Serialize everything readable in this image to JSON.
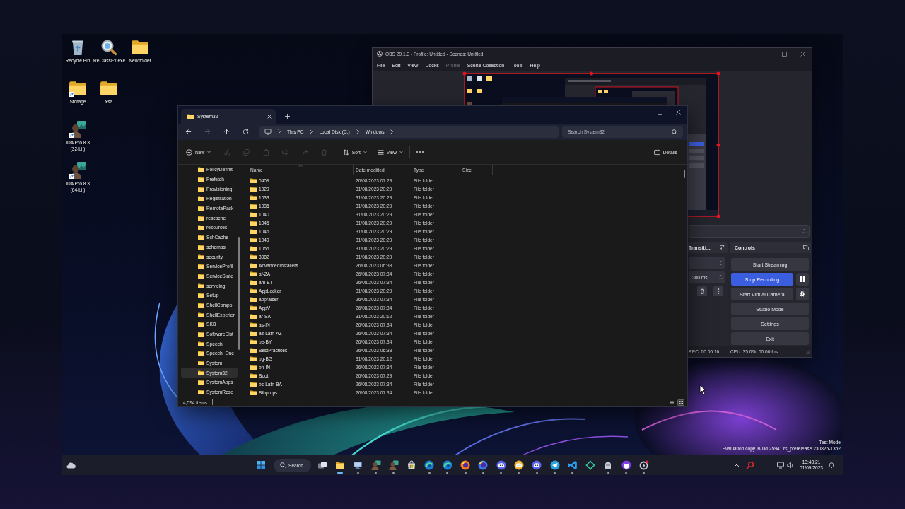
{
  "desktop_icon_rows": [
    [
      {
        "label": "Recycle Bin",
        "kind": "recycle-bin",
        "shortcut": false
      },
      {
        "label": "ReClassEx.exe",
        "kind": "magnifier-app",
        "shortcut": false
      },
      {
        "label": "New folder",
        "kind": "folder",
        "shortcut": false
      }
    ],
    [
      {
        "label": "Storage",
        "kind": "folder",
        "shortcut": true
      },
      {
        "label": "xsa",
        "kind": "folder",
        "shortcut": false
      }
    ],
    [
      {
        "label": "IDA Pro 8.3 (32-bit)",
        "kind": "portrait-app",
        "shortcut": true
      }
    ],
    [
      {
        "label": "IDA Pro 8.3 (64-bit)",
        "kind": "portrait-app",
        "shortcut": true
      }
    ]
  ],
  "obs": {
    "title": "OBS 29.1.3 - Profile: Untitled - Scenes: Untitled",
    "menu": [
      {
        "label": "File",
        "disabled": false
      },
      {
        "label": "Edit",
        "disabled": false
      },
      {
        "label": "View",
        "disabled": false
      },
      {
        "label": "Docks",
        "disabled": false
      },
      {
        "label": "Profile",
        "disabled": true
      },
      {
        "label": "Scene Collection",
        "disabled": false
      },
      {
        "label": "Tools",
        "disabled": false
      },
      {
        "label": "Help",
        "disabled": false
      }
    ],
    "transitions": {
      "title": "Transiti...",
      "duration": "300 ms"
    },
    "controls": {
      "title": "Controls",
      "buttons": [
        {
          "label": "Start Streaming",
          "active": false
        },
        {
          "label": "Stop Recording",
          "active": true,
          "side_button": {
            "kind": "pause"
          }
        },
        {
          "label": "Start Virtual Camera",
          "active": false,
          "side_button": {
            "kind": "settings"
          }
        },
        {
          "label": "Studio Mode",
          "active": false
        },
        {
          "label": "Settings",
          "active": false
        },
        {
          "label": "Exit",
          "active": false
        }
      ]
    },
    "status": {
      "recording": "REC: 00:00:16",
      "cpu": "CPU: 35.0%, 60.00 fps"
    }
  },
  "explorer": {
    "tabs": [
      {
        "title": "System32",
        "selected": true
      }
    ],
    "nav": [
      {
        "kind": "back",
        "disabled": false
      },
      {
        "kind": "forward",
        "disabled": true
      },
      {
        "kind": "up",
        "disabled": false
      },
      {
        "kind": "refresh",
        "disabled": false
      }
    ],
    "breadcrumbs": [
      "This PC",
      "Local Disk (C:)",
      "Windows"
    ],
    "search": {
      "placeholder": "Search System32"
    },
    "toolbar": {
      "new": "New",
      "actions": [
        {
          "kind": "cut",
          "disabled": true
        },
        {
          "kind": "copy",
          "disabled": true
        },
        {
          "kind": "paste",
          "disabled": true
        },
        {
          "kind": "rename",
          "disabled": true
        },
        {
          "kind": "share",
          "disabled": true
        },
        {
          "kind": "delete",
          "disabled": true
        }
      ],
      "sort": "Sort",
      "view": "View",
      "details": "Details"
    },
    "sidebar": [
      {
        "label": "PolicyDefinit",
        "selected": false
      },
      {
        "label": "Prefetch",
        "selected": false
      },
      {
        "label": "Provisioning",
        "selected": false
      },
      {
        "label": "Registration",
        "selected": false
      },
      {
        "label": "RemotePack",
        "selected": false
      },
      {
        "label": "rescache",
        "selected": false
      },
      {
        "label": "resources",
        "selected": false
      },
      {
        "label": "SchCache",
        "selected": false
      },
      {
        "label": "schemas",
        "selected": false
      },
      {
        "label": "security",
        "selected": false
      },
      {
        "label": "ServiceProfil",
        "selected": false
      },
      {
        "label": "ServiceState",
        "selected": false
      },
      {
        "label": "servicing",
        "selected": false
      },
      {
        "label": "Setup",
        "selected": false
      },
      {
        "label": "ShellCompo",
        "selected": false
      },
      {
        "label": "ShellExperien",
        "selected": false
      },
      {
        "label": "SKB",
        "selected": false
      },
      {
        "label": "SoftwareDist",
        "selected": false
      },
      {
        "label": "Speech",
        "selected": false
      },
      {
        "label": "Speech_One",
        "selected": false
      },
      {
        "label": "System",
        "selected": false
      },
      {
        "label": "System32",
        "selected": true
      },
      {
        "label": "SystemApps",
        "selected": false
      },
      {
        "label": "SystemReso",
        "selected": false
      }
    ],
    "columns": [
      "Name",
      "Date modified",
      "Type",
      "Size"
    ],
    "rows": [
      {
        "name": "0409",
        "date": "26/08/2023 07:29",
        "type": "File folder"
      },
      {
        "name": "1029",
        "date": "31/08/2023 20:29",
        "type": "File folder"
      },
      {
        "name": "1033",
        "date": "31/08/2023 20:29",
        "type": "File folder"
      },
      {
        "name": "1036",
        "date": "31/08/2023 20:29",
        "type": "File folder"
      },
      {
        "name": "1040",
        "date": "31/08/2023 20:29",
        "type": "File folder"
      },
      {
        "name": "1045",
        "date": "31/08/2023 20:29",
        "type": "File folder"
      },
      {
        "name": "1046",
        "date": "31/08/2023 20:29",
        "type": "File folder"
      },
      {
        "name": "1049",
        "date": "31/08/2023 20:29",
        "type": "File folder"
      },
      {
        "name": "1055",
        "date": "31/08/2023 20:29",
        "type": "File folder"
      },
      {
        "name": "3082",
        "date": "31/08/2023 20:29",
        "type": "File folder"
      },
      {
        "name": "AdvancedInstallers",
        "date": "26/08/2023 06:38",
        "type": "File folder"
      },
      {
        "name": "af-ZA",
        "date": "26/08/2023 07:34",
        "type": "File folder"
      },
      {
        "name": "am-ET",
        "date": "26/08/2023 07:34",
        "type": "File folder"
      },
      {
        "name": "AppLocker",
        "date": "31/08/2023 20:29",
        "type": "File folder"
      },
      {
        "name": "appraiser",
        "date": "26/08/2023 07:34",
        "type": "File folder"
      },
      {
        "name": "AppV",
        "date": "26/08/2023 07:34",
        "type": "File folder"
      },
      {
        "name": "ar-SA",
        "date": "31/08/2023 20:12",
        "type": "File folder"
      },
      {
        "name": "as-IN",
        "date": "26/08/2023 07:34",
        "type": "File folder"
      },
      {
        "name": "az-Latn-AZ",
        "date": "26/08/2023 07:34",
        "type": "File folder"
      },
      {
        "name": "be-BY",
        "date": "26/08/2023 07:34",
        "type": "File folder"
      },
      {
        "name": "BestPractices",
        "date": "26/08/2023 06:38",
        "type": "File folder"
      },
      {
        "name": "bg-BG",
        "date": "31/08/2023 20:12",
        "type": "File folder"
      },
      {
        "name": "bn-IN",
        "date": "26/08/2023 07:34",
        "type": "File folder"
      },
      {
        "name": "Boot",
        "date": "26/08/2023 07:29",
        "type": "File folder"
      },
      {
        "name": "bs-Latn-BA",
        "date": "26/08/2023 07:34",
        "type": "File folder"
      },
      {
        "name": "Bthprops",
        "date": "26/08/2023 07:34",
        "type": "File folder"
      }
    ],
    "status": "4,594 items",
    "view_modes": [
      {
        "kind": "details",
        "selected": false
      },
      {
        "kind": "tiles",
        "selected": true
      }
    ]
  },
  "system_notice": [
    "Test Mode",
    "Evaluation copy. Build 25941.rs_prerelease.230825-1352"
  ],
  "taskbar": {
    "search": "Search",
    "apps": [
      {
        "kind": "task-view",
        "running": false,
        "selected": false
      },
      {
        "kind": "folder",
        "running": true,
        "selected": true
      },
      {
        "kind": "monitor",
        "running": true,
        "selected": false
      },
      {
        "kind": "portrait-app",
        "running": true,
        "selected": false
      },
      {
        "kind": "portrait-app",
        "running": true,
        "selected": false
      },
      {
        "kind": "store",
        "running": false,
        "selected": false
      },
      {
        "kind": "swirl",
        "running": true,
        "selected": false
      },
      {
        "kind": "swirl",
        "running": true,
        "selected": false
      },
      {
        "kind": "flame-globe",
        "color": "#ff7a1a",
        "running": true,
        "selected": false
      },
      {
        "kind": "flame-globe",
        "color": "#3a7bea",
        "running": true,
        "selected": false
      },
      {
        "kind": "controller",
        "color": "#5865f2",
        "running": true,
        "selected": false
      },
      {
        "kind": "controller",
        "color": "#f0b232",
        "running": true,
        "selected": false
      },
      {
        "kind": "controller",
        "color": "#5865f2",
        "running": true,
        "selected": false
      },
      {
        "kind": "paper-plane",
        "running": true,
        "selected": false
      },
      {
        "kind": "code",
        "running": true,
        "selected": false
      },
      {
        "kind": "diamond",
        "running": false,
        "selected": false
      },
      {
        "kind": "ghost",
        "running": true,
        "selected": false
      },
      {
        "kind": "cat",
        "running": true,
        "selected": false
      },
      {
        "kind": "ring",
        "running": true,
        "selected": false
      }
    ],
    "clock": {
      "time": "13:48:21",
      "date": "01/09/2023"
    }
  }
}
